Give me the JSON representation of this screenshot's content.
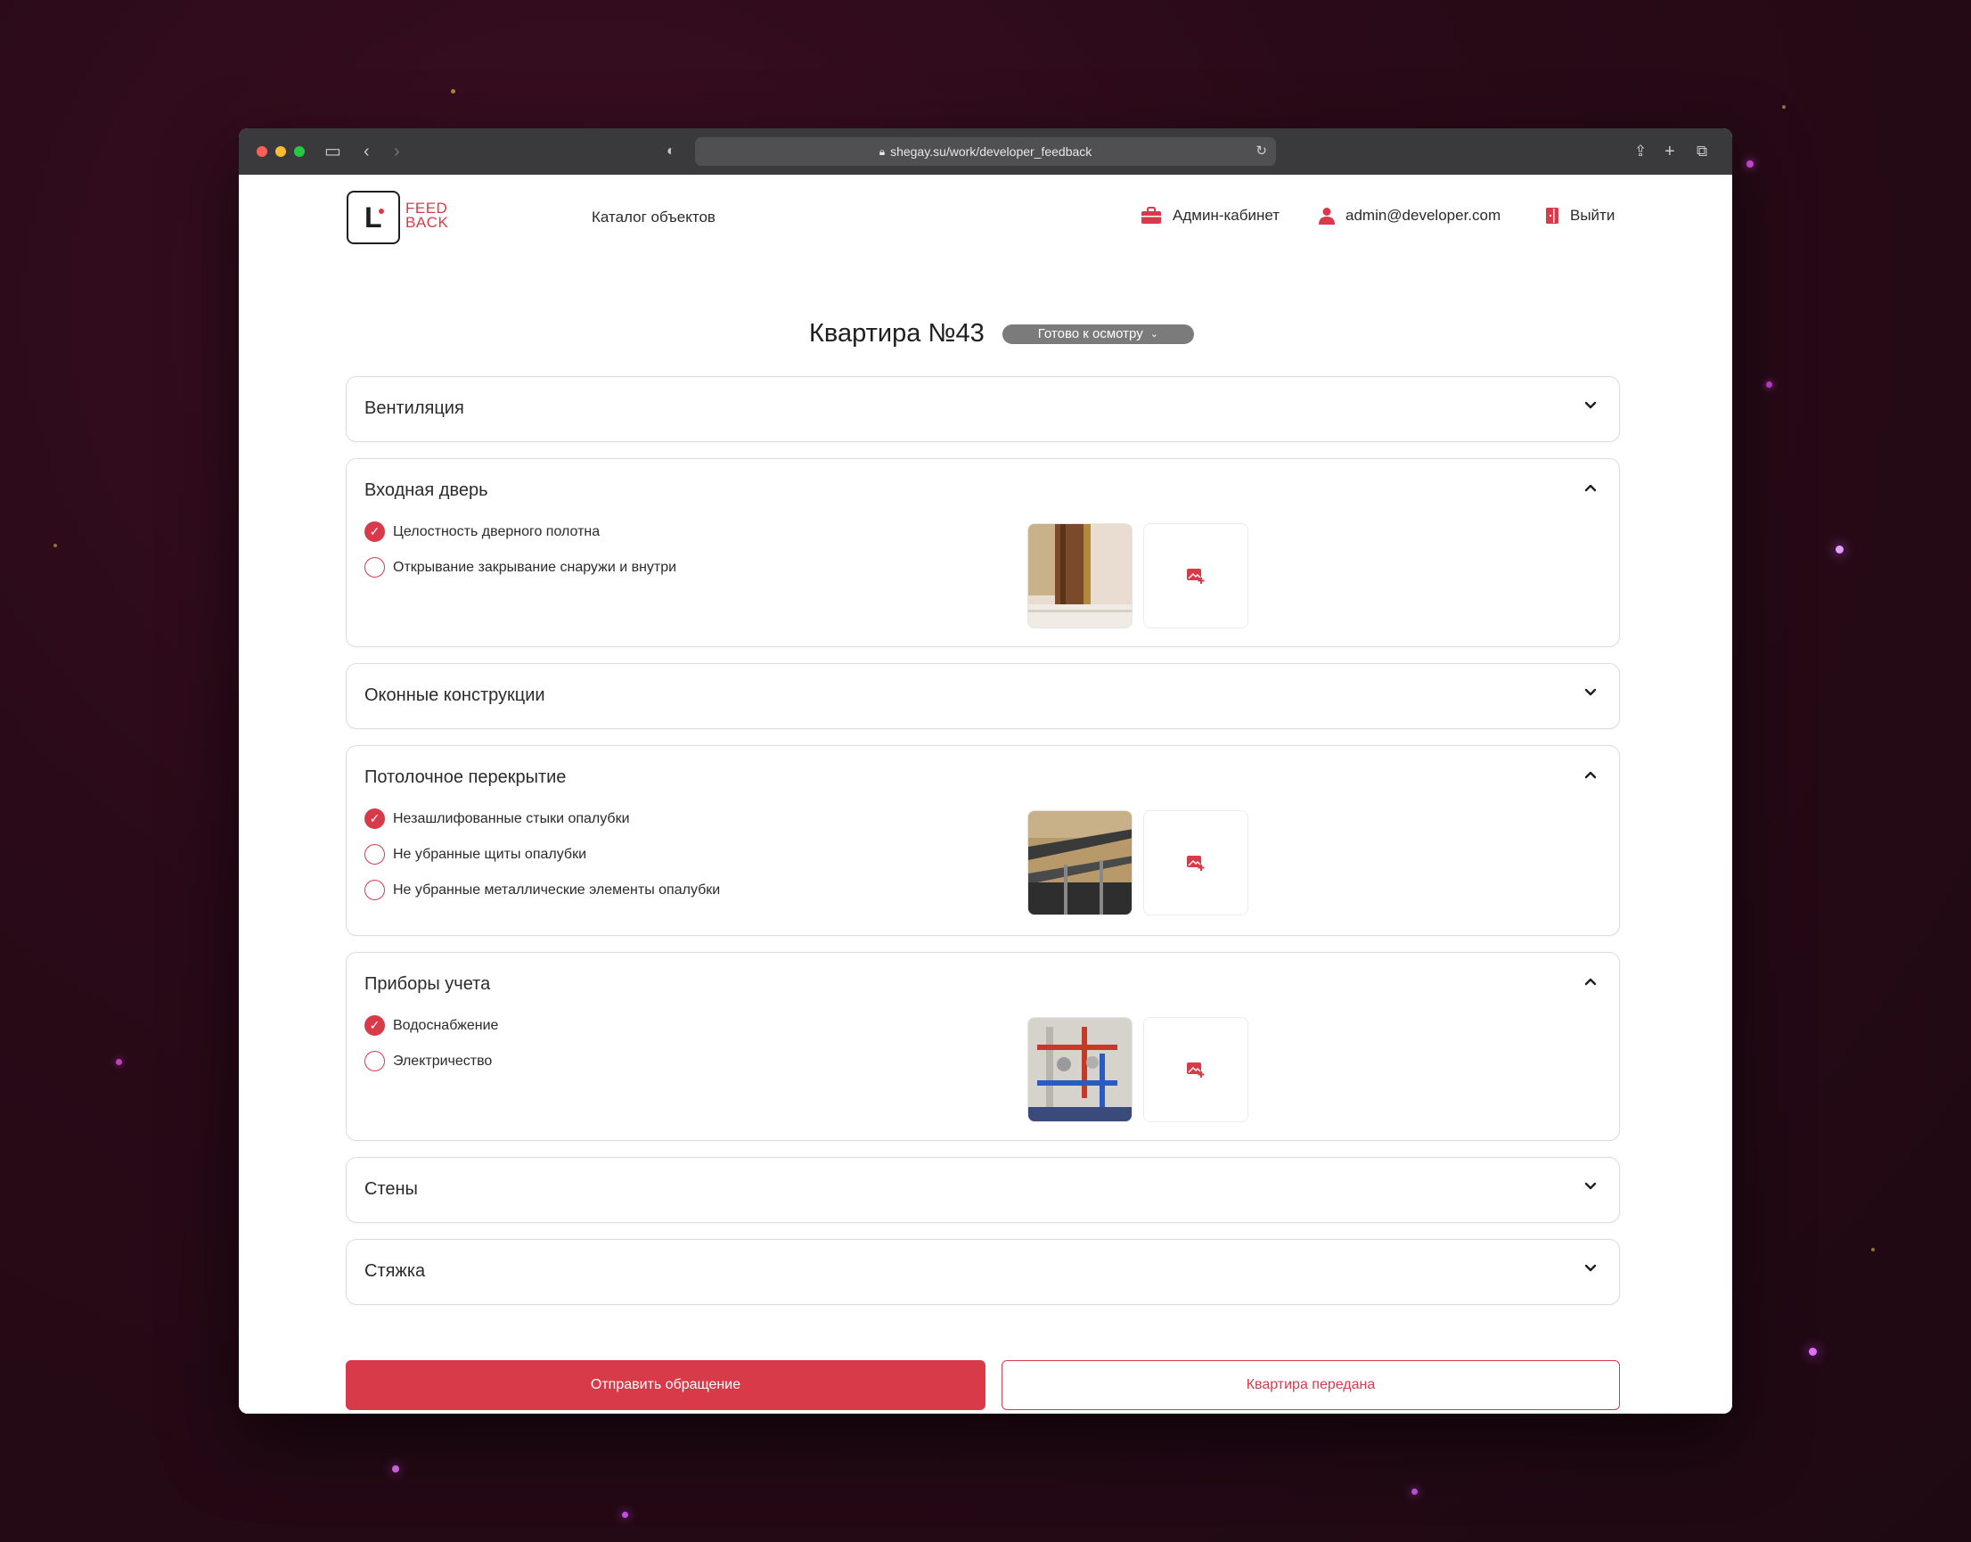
{
  "browser": {
    "url": "shegay.su/work/developer_feedback"
  },
  "header": {
    "logo_text_line1": "FEED",
    "logo_text_line2": "BACK",
    "nav_catalog": "Каталог объектов",
    "admin_cabinet": "Админ-кабинет",
    "user_email": "admin@developer.com",
    "logout": "Выйти"
  },
  "apartment": {
    "title": "Квартира №43",
    "status": "Готово к осмотру"
  },
  "sections": [
    {
      "title": "Вентиляция",
      "expanded": false
    },
    {
      "title": "Входная дверь",
      "expanded": true,
      "items": [
        {
          "label": "Целостность дверного полотна",
          "checked": true
        },
        {
          "label": "Открывание закрывание снаружи и внутри",
          "checked": false
        }
      ]
    },
    {
      "title": "Оконные конструкции",
      "expanded": false
    },
    {
      "title": "Потолочное перекрытие",
      "expanded": true,
      "items": [
        {
          "label": "Незашлифованные стыки опалубки",
          "checked": true
        },
        {
          "label": "Не убранные щиты опалубки",
          "checked": false
        },
        {
          "label": "Не убранные металлические элементы опалубки",
          "checked": false
        }
      ]
    },
    {
      "title": "Приборы учета",
      "expanded": true,
      "items": [
        {
          "label": "Водоснабжение",
          "checked": true
        },
        {
          "label": "Электричество",
          "checked": false
        }
      ]
    },
    {
      "title": "Стены",
      "expanded": false
    },
    {
      "title": "Стяжка",
      "expanded": false
    }
  ],
  "actions": {
    "submit": "Отправить обращение",
    "handed_over": "Квартира передана"
  },
  "colors": {
    "accent": "#d93a4a",
    "status_pill": "#7b7b7b"
  },
  "icons": {
    "admin": "briefcase-icon",
    "user": "user-icon",
    "logout": "door-exit-icon",
    "add_photo": "add-image-icon"
  }
}
